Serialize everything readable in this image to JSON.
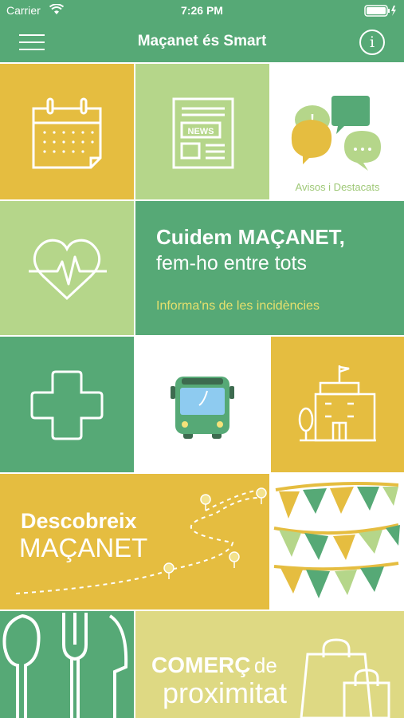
{
  "status": {
    "carrier": "Carrier",
    "time": "7:26 PM"
  },
  "nav": {
    "title": "Maçanet és Smart",
    "info_label": "i"
  },
  "tiles": {
    "avisos": "Avisos i Destacats",
    "news": "NEWS",
    "cuidem": {
      "title": "Cuidem MAÇANET,",
      "subtitle": "fem-ho entre tots",
      "link": "Informa'ns de les incidències"
    },
    "descobreix": {
      "line1": "Descobreix",
      "line2": "MAÇANET"
    },
    "comerc": {
      "line1_bold": "COMERÇ",
      "line1_rest": "de",
      "line2": "proximitat"
    }
  },
  "colors": {
    "green": "#56a976",
    "yellow": "#e5bd40",
    "light_green": "#b5d68a",
    "pale_yellow": "#ded983"
  }
}
